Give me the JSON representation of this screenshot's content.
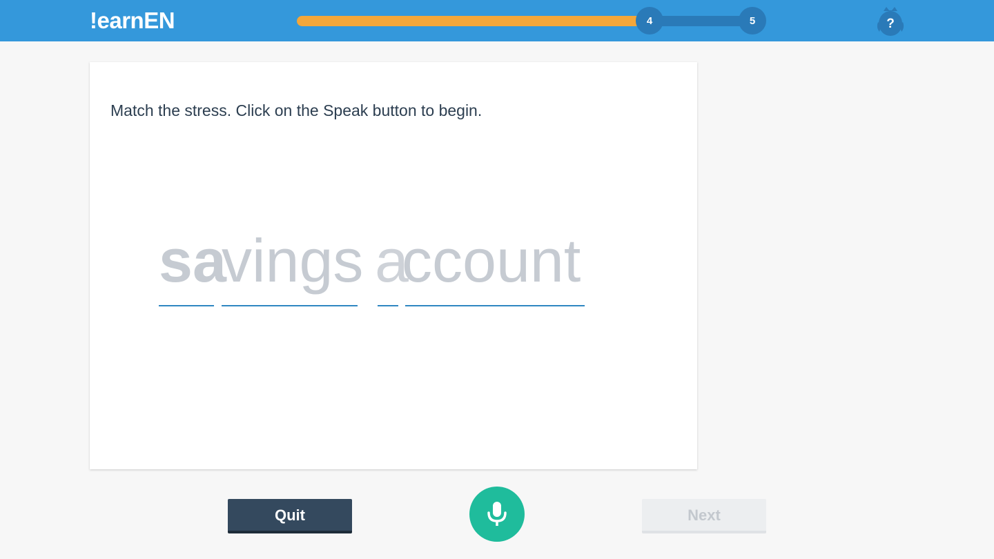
{
  "header": {
    "logo_text": "!earnEN",
    "progress": {
      "fill_fraction": 0.77,
      "current_step": "4",
      "next_step": "5"
    },
    "help_icon": "owl-question-icon"
  },
  "exercise": {
    "instruction": "Match the stress. Click on the Speak button to begin.",
    "syllables": [
      {
        "text": "sa",
        "stressed": true
      },
      {
        "text": "vings",
        "stressed": false
      },
      {
        "text": "a",
        "stressed": false,
        "reduced": true
      },
      {
        "text": "ccount",
        "stressed": false
      }
    ]
  },
  "actions": {
    "quit_label": "Quit",
    "speak_icon": "microphone-icon",
    "next_label": "Next",
    "next_disabled": true
  },
  "colors": {
    "header_bg": "#3498db",
    "progress_fill": "#f4a73a",
    "progress_track": "#2a7ab8",
    "quit_bg": "#34495e",
    "mic_bg": "#1fbc9c",
    "syllable_underline": "#2e86c1"
  }
}
